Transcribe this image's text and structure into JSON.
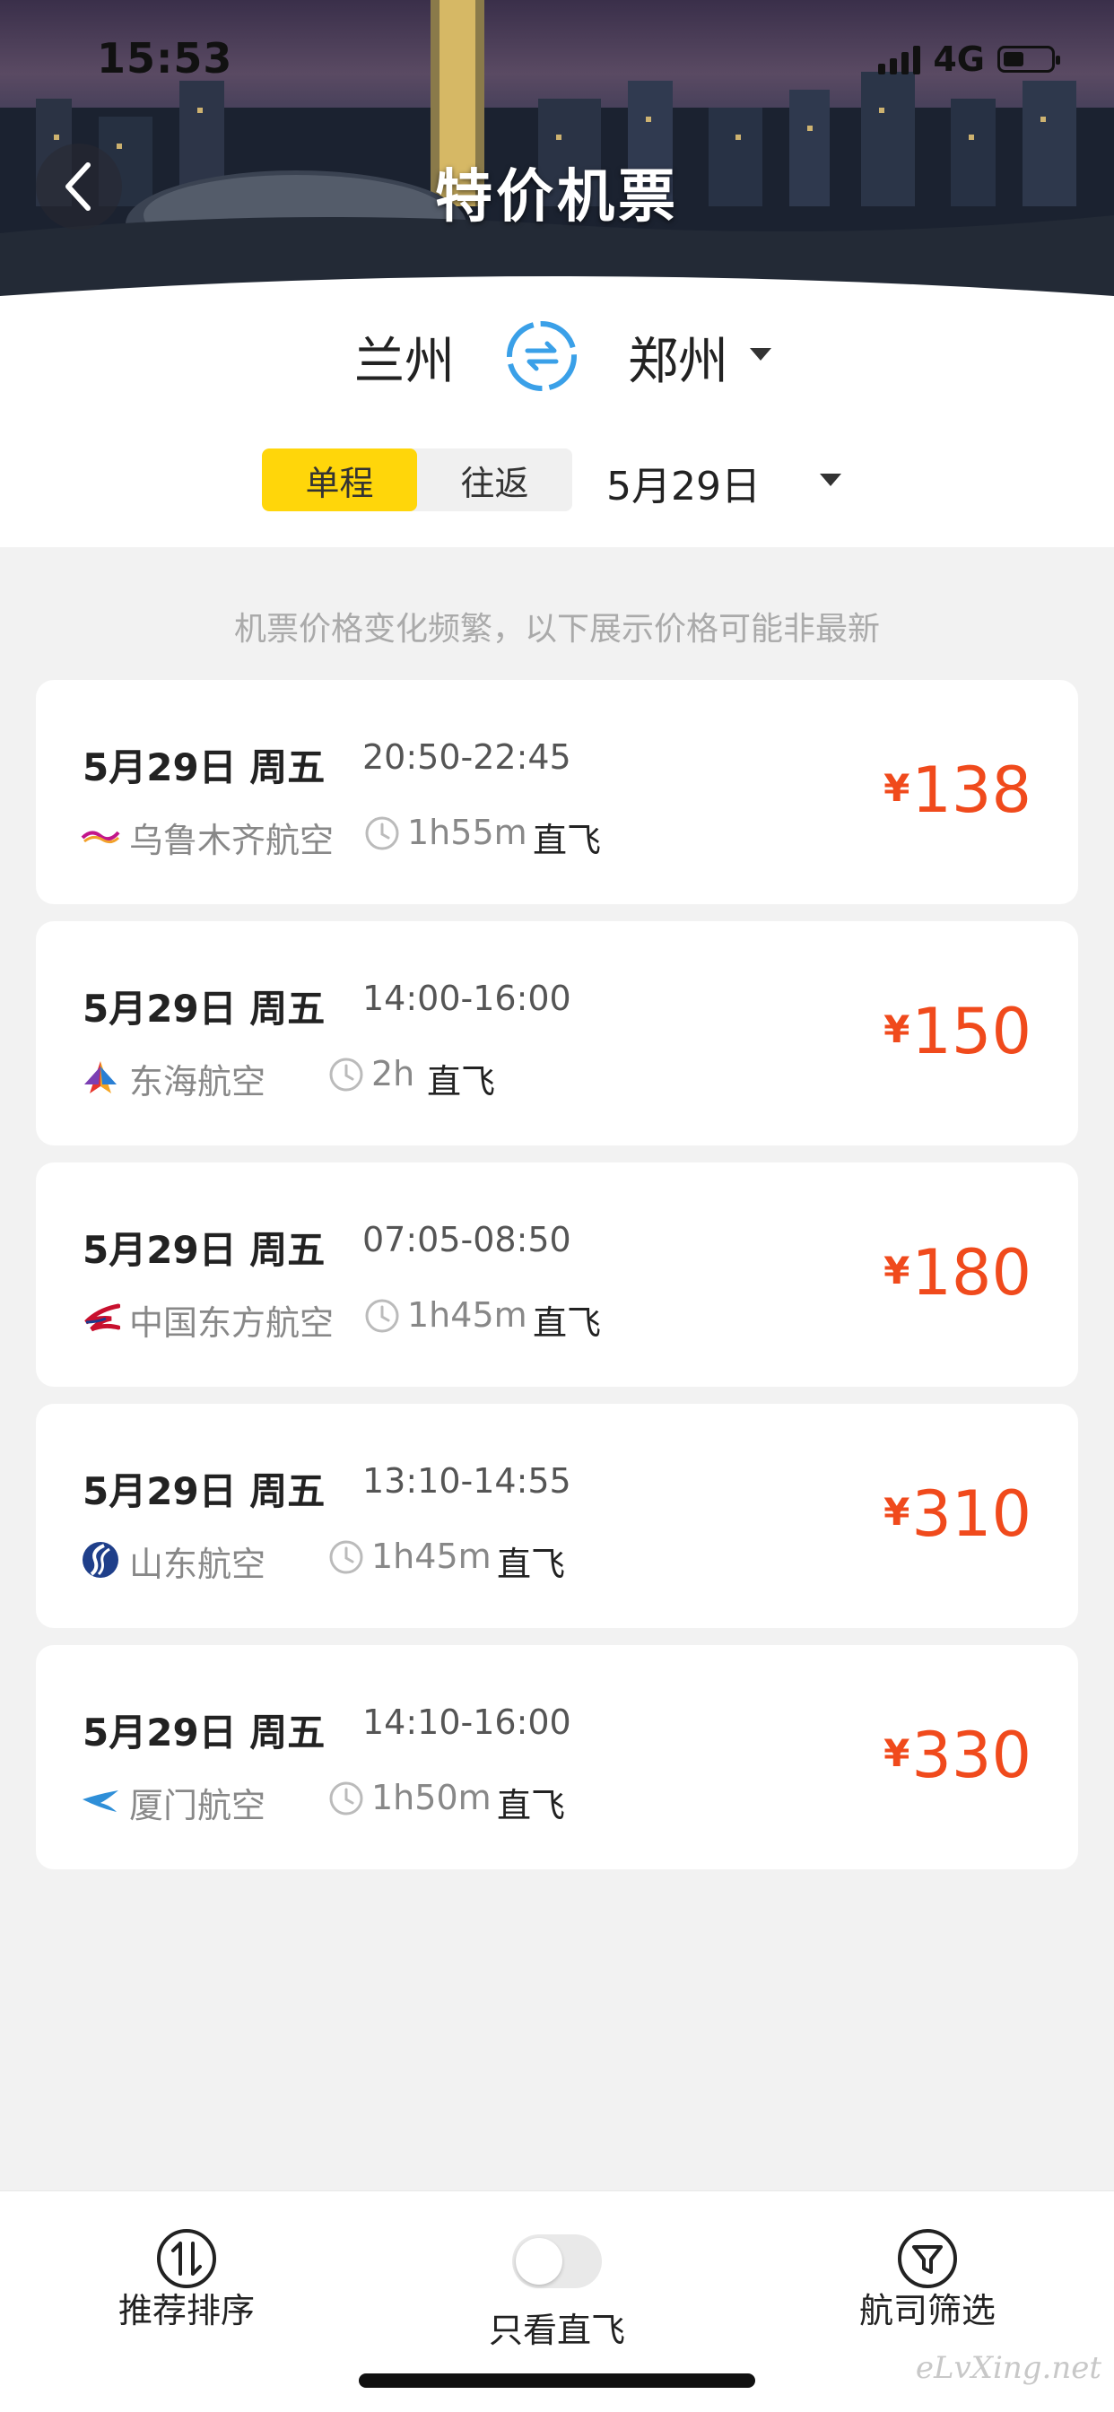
{
  "status_bar": {
    "time": "15:53",
    "network": "4G"
  },
  "header": {
    "title": "特价机票"
  },
  "route": {
    "from_city": "兰州",
    "to_city": "郑州"
  },
  "trip_type": {
    "options": [
      "单程",
      "往返"
    ],
    "selected": "单程"
  },
  "date_selector": {
    "value": "5月29日"
  },
  "notice": "机票价格变化频繁，以下展示价格可能非最新",
  "flights": [
    {
      "date": "5月29日 周五",
      "time": "20:50-22:45",
      "airline": "乌鲁木齐航空",
      "duration": "1h55m",
      "stop": "直飞",
      "currency": "¥",
      "price": "138"
    },
    {
      "date": "5月29日 周五",
      "time": "14:00-16:00",
      "airline": "东海航空",
      "duration": "2h",
      "stop": "直飞",
      "currency": "¥",
      "price": "150"
    },
    {
      "date": "5月29日 周五",
      "time": "07:05-08:50",
      "airline": "中国东方航空",
      "duration": "1h45m",
      "stop": "直飞",
      "currency": "¥",
      "price": "180"
    },
    {
      "date": "5月29日 周五",
      "time": "13:10-14:55",
      "airline": "山东航空",
      "duration": "1h45m",
      "stop": "直飞",
      "currency": "¥",
      "price": "310"
    },
    {
      "date": "5月29日 周五",
      "time": "14:10-16:00",
      "airline": "厦门航空",
      "duration": "1h50m",
      "stop": "直飞",
      "currency": "¥",
      "price": "330"
    }
  ],
  "bottom_bar": {
    "sort_label": "推荐排序",
    "direct_only_label": "只看直飞",
    "direct_only_enabled": false,
    "filter_label": "航司筛选"
  },
  "watermark": "eLvXing.net",
  "colors": {
    "accent": "#ffd60a",
    "price": "#f04a1c",
    "swap": "#3aa0e8"
  }
}
